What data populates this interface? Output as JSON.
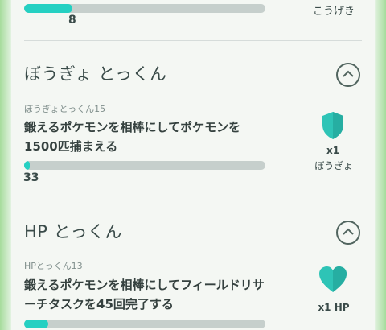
{
  "top": {
    "progress_value": "8",
    "progress_fraction": 0.2,
    "reward_name": "こうげき"
  },
  "sections": [
    {
      "title": "ぼうぎょ とっくん",
      "task": {
        "subtitle": "ぼうぎょとっくん15",
        "description": "鍛えるポケモンを相棒にしてポケモンを1500匹捕まえる",
        "progress_value": "33",
        "progress_fraction": 0.022
      },
      "reward": {
        "qty": "x1",
        "name": "ぼうぎょ",
        "icon": "shield-icon",
        "color": "#2ec4b6"
      }
    },
    {
      "title": "HP とっくん",
      "task": {
        "subtitle": "HPとっくん13",
        "description": "鍛えるポケモンを相棒にしてフィールドリサーチタスクを45回完了する",
        "progress_value": "",
        "progress_fraction": 0.1
      },
      "reward": {
        "qty": "x1 HP",
        "name": "",
        "icon": "heart-icon",
        "color": "#2ec4b6"
      }
    }
  ],
  "colors": {
    "accent": "#25d0c2",
    "bar_track": "#c6cfcc",
    "text": "#3a4b49"
  }
}
